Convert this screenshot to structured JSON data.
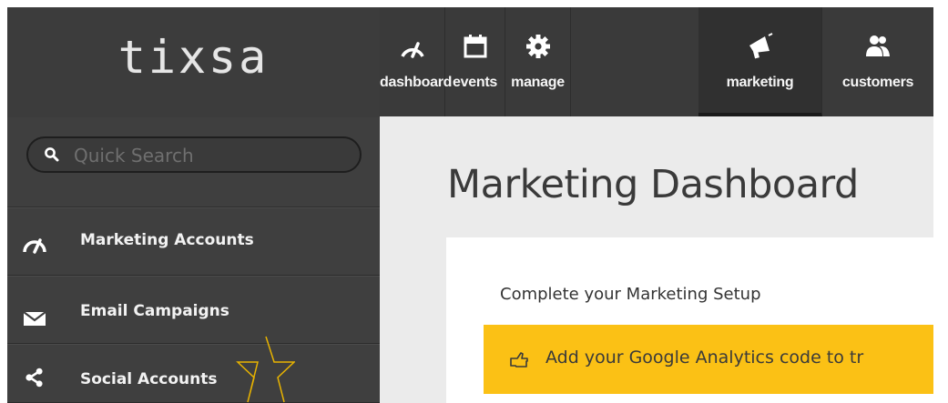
{
  "brand": {
    "logo_text": "tixsa"
  },
  "search": {
    "placeholder": "Quick Search"
  },
  "sidebar": {
    "items": [
      {
        "label": "Marketing Accounts",
        "icon": "gauge-icon"
      },
      {
        "label": "Email Campaigns",
        "icon": "envelope-icon"
      },
      {
        "label": "Social Accounts",
        "icon": "share-icon"
      }
    ]
  },
  "topnav": {
    "tabs": [
      {
        "label": "dashboard",
        "icon": "gauge-icon",
        "active": false
      },
      {
        "label": "events",
        "icon": "calendar-icon",
        "active": false
      },
      {
        "label": "manage",
        "icon": "gear-icon",
        "active": false
      },
      {
        "label": "marketing",
        "icon": "megaphone-icon",
        "active": true
      },
      {
        "label": "customers",
        "icon": "users-icon",
        "active": false
      }
    ]
  },
  "main": {
    "title": "Marketing Dashboard",
    "setup_heading": "Complete your Marketing Setup",
    "alert_text": "Add your Google Analytics code to tr"
  },
  "colors": {
    "sidebar_bg": "#3f3f3f",
    "topnav_bg": "#3a3a3a",
    "main_bg": "#ebebeb",
    "alert_bg": "#fbc115"
  }
}
